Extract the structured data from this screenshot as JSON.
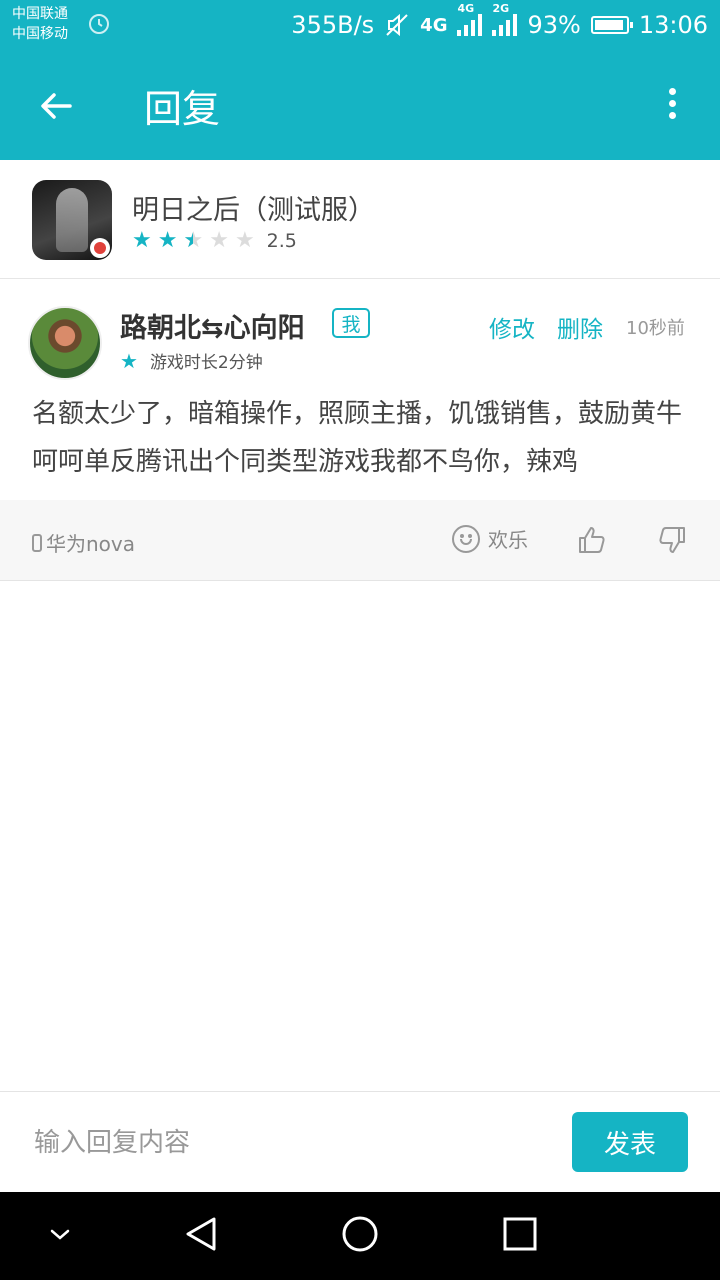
{
  "status_bar": {
    "carrier1": "中国联通",
    "carrier2": "中国移动",
    "speed": "355B/s",
    "network1": "4G",
    "network2": "4G",
    "network3": "2G",
    "battery": "93%",
    "battery_level": 0.93,
    "time": "13:06"
  },
  "app_bar": {
    "title": "回复",
    "back_icon": "arrow-left-icon",
    "menu_icon": "more-vertical-icon"
  },
  "game": {
    "name": "明日之后（测试服）",
    "rating": "2.5",
    "rating_value": 2.5
  },
  "review": {
    "username": "路朝北⇆心向阳",
    "mine_badge": "我",
    "edit": "修改",
    "delete": "删除",
    "time": "10秒前",
    "play_time": "游戏时长2分钟",
    "content": "名额太少了，暗箱操作，照顾主播，饥饿销售，鼓励黄牛呵呵单反腾讯出个同类型游戏我都不鸟你，辣鸡",
    "device": "华为nova",
    "mood": "欢乐"
  },
  "reply": {
    "placeholder": "输入回复内容",
    "value": "",
    "send": "发表"
  },
  "colors": {
    "accent": "#15b4c4",
    "text": "#444444",
    "muted": "#999999"
  }
}
